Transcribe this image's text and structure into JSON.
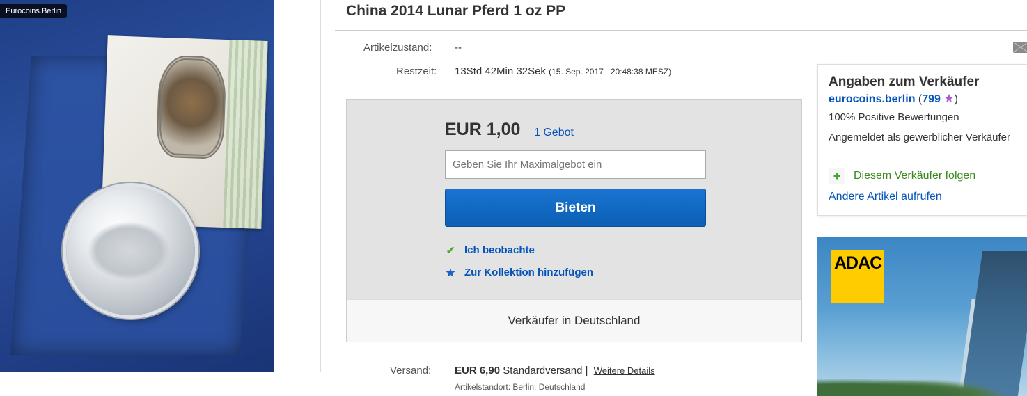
{
  "listing": {
    "title": "China 2014 Lunar Pferd 1 oz PP",
    "image_watermark": "Eurocoins.Berlin",
    "condition_label": "Artikelzustand:",
    "condition_value": "--",
    "time_label": "Restzeit:",
    "time_left": "13Std 42Min 32Sek",
    "end_date": "(15. Sep. 2017   20:48:38 MESZ)"
  },
  "bid": {
    "price": "EUR 1,00",
    "bid_count": "1 Gebot",
    "max_bid_placeholder": "Geben Sie Ihr Maximalgebot ein",
    "bid_button": "Bieten",
    "watch_label": "Ich beobachte",
    "collection_label": "Zur Kollektion hinzufügen",
    "seller_location_note": "Verkäufer in Deutschland"
  },
  "shipping": {
    "label": "Versand:",
    "price": "EUR 6,90",
    "method": "Standardversand |",
    "details_link": "Weitere Details",
    "location": "Artikelstandort:  Berlin, Deutschland"
  },
  "seller": {
    "heading": "Angaben zum Verkäufer",
    "name": "eurocoins.berlin",
    "score_open": "(",
    "score": "799",
    "score_close": ")",
    "positive": "100% Positive Bewertungen",
    "type": "Angemeldet als gewerblicher Verkäufer",
    "follow": "Diesem Verkäufer folgen",
    "other_items": "Andere Artikel aufrufen"
  },
  "ad": {
    "brand": "ADAC"
  },
  "colors": {
    "link_blue": "#0654ba",
    "button_blue": "#0b5fb4",
    "follow_green": "#3c8a1e",
    "adac_yellow": "#ffcc00"
  },
  "icons": [
    "mail-icon",
    "check-icon",
    "star-icon",
    "plus-icon",
    "rating-star-icon"
  ]
}
